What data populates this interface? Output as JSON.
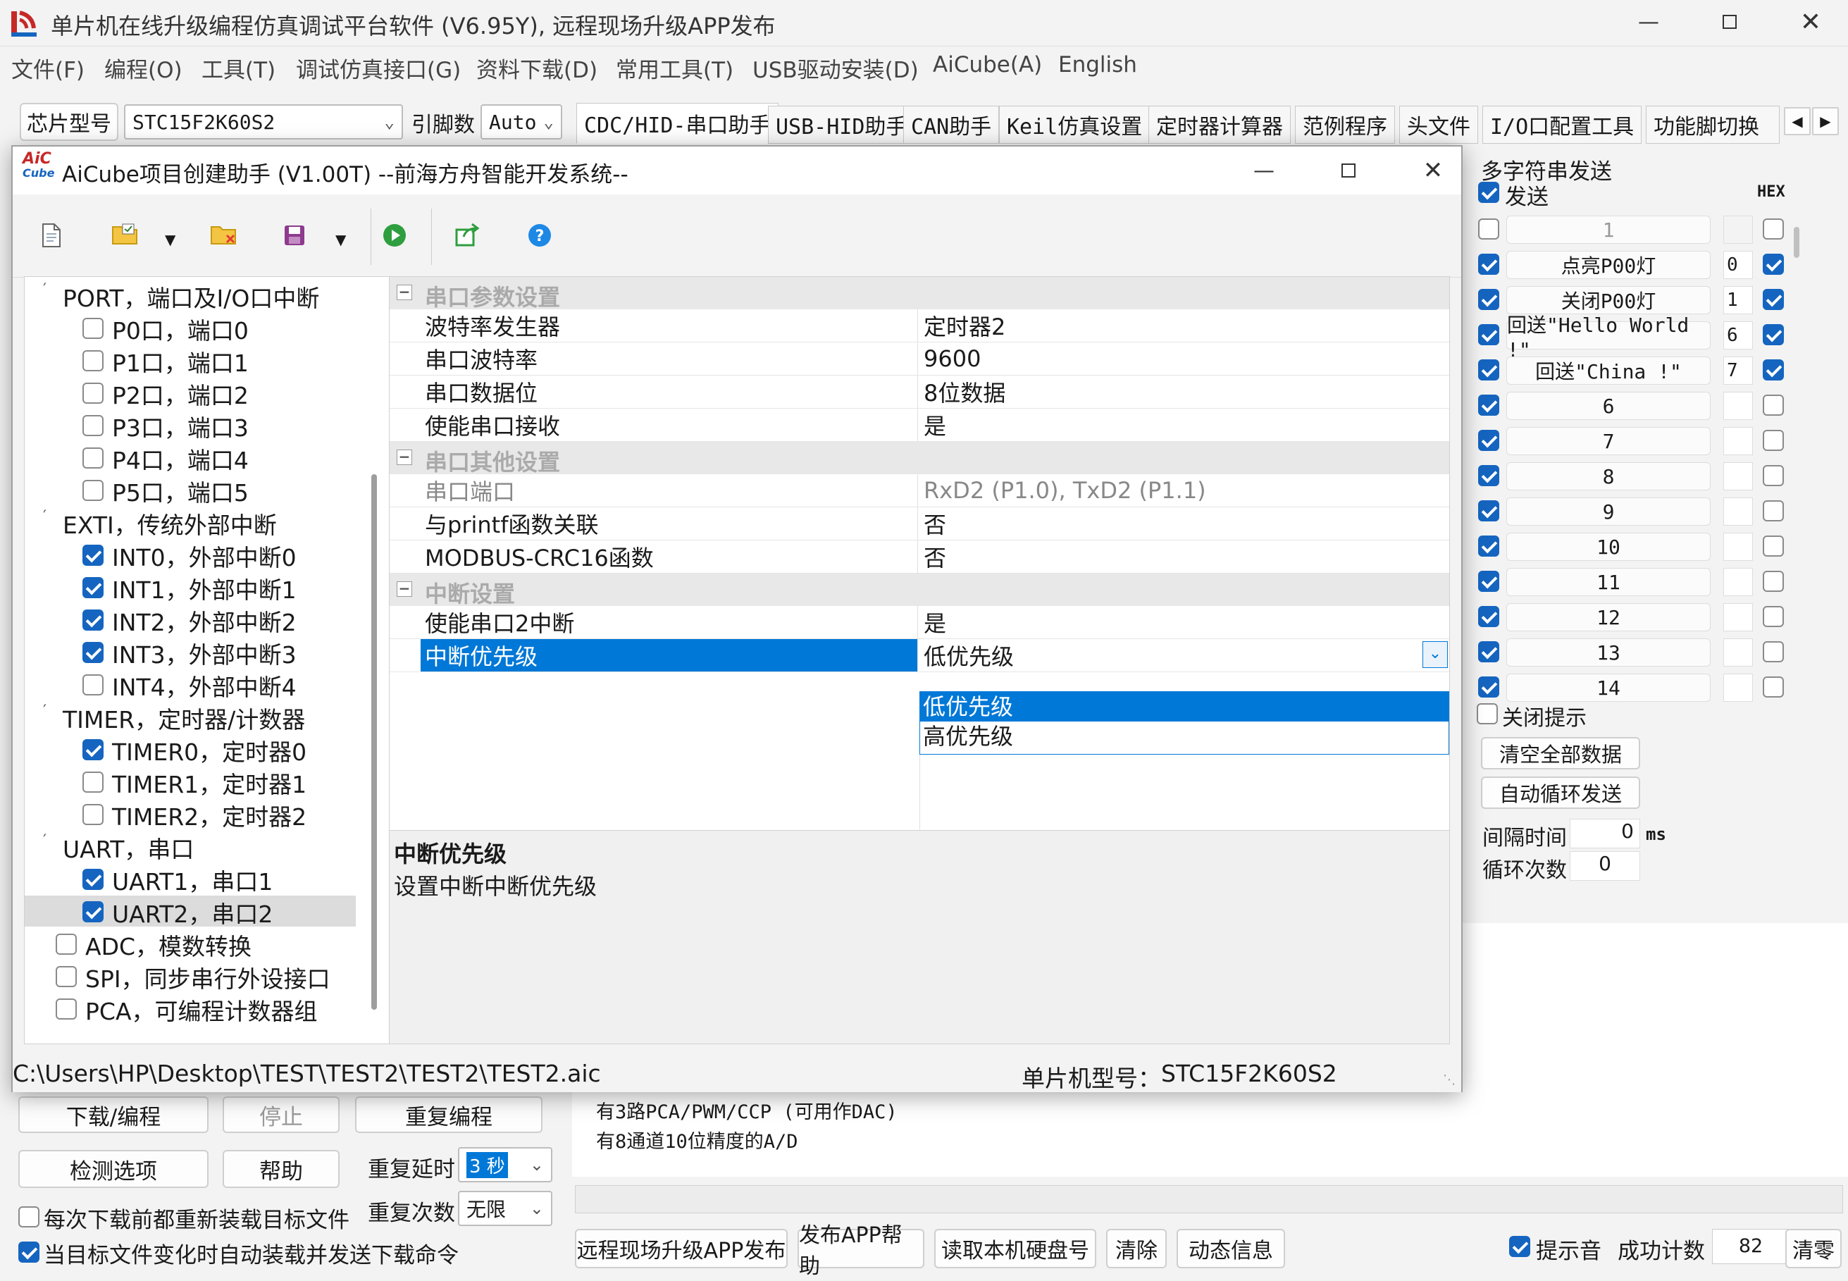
{
  "app": {
    "title": "单片机在线升级编程仿真调试平台软件 (V6.95Y), 远程现场升级APP发布"
  },
  "menu": [
    "文件(F)",
    "编程(O)",
    "工具(T)",
    "调试仿真接口(G)",
    "资料下载(D)",
    "常用工具(T)",
    "USB驱动安装(D)",
    "AiCube(A)",
    "English"
  ],
  "toolbar": {
    "chip_label": "芯片型号",
    "chip_value": "STC15F2K60S2",
    "pin_label": "引脚数",
    "pin_value": "Auto"
  },
  "tabs": [
    "CDC/HID-串口助手",
    "USB-HID助手",
    "CAN助手",
    "Keil仿真设置",
    "定时器计算器",
    "范例程序",
    "头文件",
    "I/O口配置工具",
    "功能脚切换"
  ],
  "right_panel": {
    "group_title": "多字符串发送",
    "send_header": "发送",
    "hex_header": "HEX",
    "rows": [
      {
        "label": "1",
        "value": "",
        "checked": false,
        "hex": false
      },
      {
        "label": "点亮P00灯",
        "value": "0",
        "checked": true,
        "hex": true
      },
      {
        "label": "关闭P00灯",
        "value": "1",
        "checked": true,
        "hex": true
      },
      {
        "label": "回送\"Hello World !\"",
        "value": "6",
        "checked": true,
        "hex": true
      },
      {
        "label": "回送\"China !\"",
        "value": "7",
        "checked": true,
        "hex": true
      },
      {
        "label": "6",
        "value": "",
        "checked": true,
        "hex": false
      },
      {
        "label": "7",
        "value": "",
        "checked": true,
        "hex": false
      },
      {
        "label": "8",
        "value": "",
        "checked": true,
        "hex": false
      },
      {
        "label": "9",
        "value": "",
        "checked": true,
        "hex": false
      },
      {
        "label": "10",
        "value": "",
        "checked": true,
        "hex": false
      },
      {
        "label": "11",
        "value": "",
        "checked": true,
        "hex": false
      },
      {
        "label": "12",
        "value": "",
        "checked": true,
        "hex": false
      },
      {
        "label": "13",
        "value": "",
        "checked": true,
        "hex": false
      },
      {
        "label": "14",
        "value": "",
        "checked": true,
        "hex": false
      }
    ],
    "close_hint": "关闭提示",
    "clear_all": "清空全部数据",
    "auto_loop": "自动循环发送",
    "interval_label": "间隔时间",
    "interval_value": "0",
    "interval_unit": "ms",
    "loop_label": "循环次数",
    "loop_value": "0"
  },
  "bottom": {
    "download": "下载/编程",
    "stop": "停止",
    "reprogram": "重复编程",
    "check_options": "检测选项",
    "help": "帮助",
    "repeat_delay_label": "重复延时",
    "repeat_delay_value": "3 秒",
    "repeat_count_label": "重复次数",
    "repeat_count_value": "无限",
    "reload_each": "每次下载前都重新装载目标文件",
    "auto_send": "当目标文件变化时自动装载并发送下载命令",
    "log_lines": [
      "有3路PCA/PWM/CCP (可用作DAC)",
      "有8通道10位精度的A/D"
    ],
    "publish_app": "远程现场升级APP发布",
    "publish_help": "发布APP帮助",
    "read_disk": "读取本机硬盘号",
    "clear": "清除",
    "dynamic": "动态信息",
    "beep": "提示音",
    "success_label": "成功计数",
    "success_value": "82",
    "clear_zero": "清零"
  },
  "dialog": {
    "title": "AiCube项目创建助手 (V1.00T) --前海方舟智能开发系统--",
    "logo_top": "AiC",
    "logo_bottom": "Cube",
    "tree": [
      {
        "label": "PORT，端口及I/O口中断",
        "level": 0,
        "checked": null
      },
      {
        "label": "P0口，端口0",
        "level": 1,
        "checked": false
      },
      {
        "label": "P1口，端口1",
        "level": 1,
        "checked": false
      },
      {
        "label": "P2口，端口2",
        "level": 1,
        "checked": false
      },
      {
        "label": "P3口，端口3",
        "level": 1,
        "checked": false
      },
      {
        "label": "P4口，端口4",
        "level": 1,
        "checked": false
      },
      {
        "label": "P5口，端口5",
        "level": 1,
        "checked": false
      },
      {
        "label": "EXTI，传统外部中断",
        "level": 0,
        "checked": null
      },
      {
        "label": "INT0，外部中断0",
        "level": 1,
        "checked": true
      },
      {
        "label": "INT1，外部中断1",
        "level": 1,
        "checked": true
      },
      {
        "label": "INT2，外部中断2",
        "level": 1,
        "checked": true
      },
      {
        "label": "INT3，外部中断3",
        "level": 1,
        "checked": true
      },
      {
        "label": "INT4，外部中断4",
        "level": 1,
        "checked": false
      },
      {
        "label": "TIMER，定时器/计数器",
        "level": 0,
        "checked": null
      },
      {
        "label": "TIMER0，定时器0",
        "level": 1,
        "checked": true
      },
      {
        "label": "TIMER1，定时器1",
        "level": 1,
        "checked": false
      },
      {
        "label": "TIMER2，定时器2",
        "level": 1,
        "checked": false
      },
      {
        "label": "UART，串口",
        "level": 0,
        "checked": null
      },
      {
        "label": "UART1，串口1",
        "level": 1,
        "checked": true
      },
      {
        "label": "UART2，串口2",
        "level": 1,
        "checked": true,
        "selected": true
      },
      {
        "label": "ADC，模数转换",
        "level": 2,
        "checked": false
      },
      {
        "label": "SPI，同步串行外设接口",
        "level": 2,
        "checked": false
      },
      {
        "label": "PCA，可编程计数器组",
        "level": 2,
        "checked": false
      }
    ],
    "props": [
      {
        "type": "cat",
        "label": "串口参数设置"
      },
      {
        "type": "row",
        "name": "波特率发生器",
        "value": "定时器2"
      },
      {
        "type": "row",
        "name": "串口波特率",
        "value": "9600"
      },
      {
        "type": "row",
        "name": "串口数据位",
        "value": "8位数据"
      },
      {
        "type": "row",
        "name": "使能串口接收",
        "value": "是"
      },
      {
        "type": "cat",
        "label": "串口其他设置"
      },
      {
        "type": "row",
        "name": "串口端口",
        "value": "RxD2 (P1.0), TxD2 (P1.1)",
        "disabled": true
      },
      {
        "type": "row",
        "name": "与printf函数关联",
        "value": "否"
      },
      {
        "type": "row",
        "name": "MODBUS-CRC16函数",
        "value": "否"
      },
      {
        "type": "cat",
        "label": "中断设置"
      },
      {
        "type": "row",
        "name": "使能串口2中断",
        "value": "是"
      },
      {
        "type": "row",
        "name": "中断优先级",
        "value": "低优先级",
        "selected": true
      }
    ],
    "dropdown_options": [
      "低优先级",
      "高优先级"
    ],
    "desc_title": "中断优先级",
    "desc_text": "设置中断中断优先级",
    "status_path": "C:\\Users\\HP\\Desktop\\TEST\\TEST2\\TEST2\\TEST2.aic",
    "status_chip_label": "单片机型号：",
    "status_chip_value": "STC15F2K60S2"
  },
  "colors": {
    "accent": "#0078d7",
    "check": "#1565c0",
    "selection": "#0078d7"
  }
}
